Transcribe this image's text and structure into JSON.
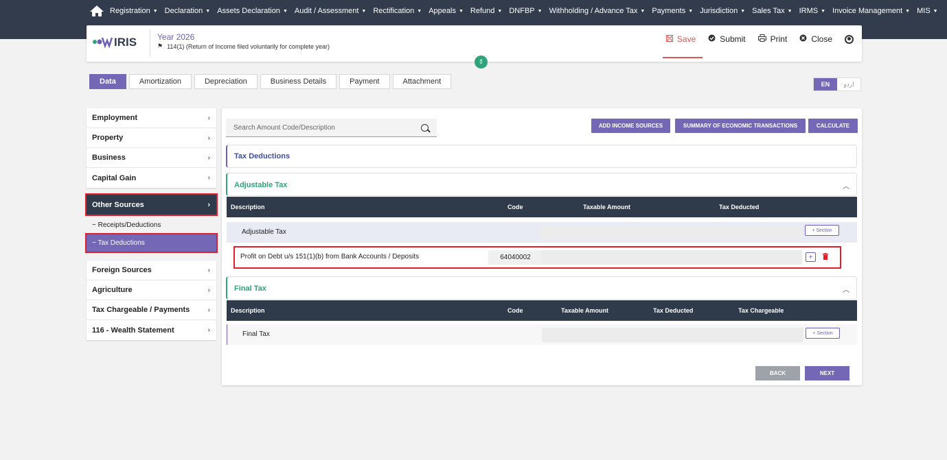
{
  "nav": {
    "items": [
      "Registration",
      "Declaration",
      "Assets Declaration",
      "Audit / Assessment",
      "Rectification",
      "Appeals",
      "Refund",
      "DNFBP",
      "Withholding / Advance Tax",
      "Payments",
      "Jurisdiction",
      "Sales Tax",
      "IRMS",
      "Invoice Management",
      "MIS"
    ],
    "caret": "▼"
  },
  "header": {
    "logo_text": "IRIS",
    "year": "Year 2026",
    "return_type": "114(1) (Return of Income filed voluntarily for complete year)",
    "save": "Save",
    "submit": "Submit",
    "print": "Print",
    "close": "Close"
  },
  "tabs": [
    "Data",
    "Amortization",
    "Depreciation",
    "Business Details",
    "Payment",
    "Attachment"
  ],
  "lang": {
    "en": "EN",
    "ur": "اردو"
  },
  "sidebar": {
    "group1": [
      "Employment",
      "Property",
      "Business",
      "Capital Gain"
    ],
    "other_sources": "Other Sources",
    "sub_receipts": "− Receipts/Deductions",
    "sub_tax_deductions": "− Tax Deductions",
    "group2": [
      "Foreign Sources",
      "Agriculture",
      "Tax Chargeable / Payments",
      "116 - Wealth Statement"
    ],
    "chevron": "›"
  },
  "main": {
    "search_placeholder": "Search Amount Code/Description",
    "add_income": "ADD INCOME SOURCES",
    "summary": "SUMMARY OF ECONOMIC TRANSACTIONS",
    "calculate": "CALCULATE",
    "tax_deductions_title": "Tax Deductions",
    "adjustable": {
      "title": "Adjustable Tax",
      "headers": [
        "Description",
        "Code",
        "Taxable Amount",
        "Tax Deducted"
      ],
      "row_label": "Adjustable Tax",
      "section_btn": "+ Section",
      "entry_desc": "Profit on Debt u/s 151(1)(b) from Bank Accounts / Deposits",
      "entry_code": "64040002",
      "plus": "+"
    },
    "final": {
      "title": "Final Tax",
      "headers": [
        "Description",
        "Code",
        "Taxable Amount",
        "Tax Deducted",
        "Tax Chargeable"
      ],
      "row_label": "Final Tax",
      "section_btn": "+ Section"
    },
    "back": "BACK",
    "next": "NEXT"
  },
  "colors": {
    "accent": "#7467b6",
    "nav_bg": "#323c4c",
    "green": "#2fa37a",
    "highlight": "#e41e26"
  }
}
